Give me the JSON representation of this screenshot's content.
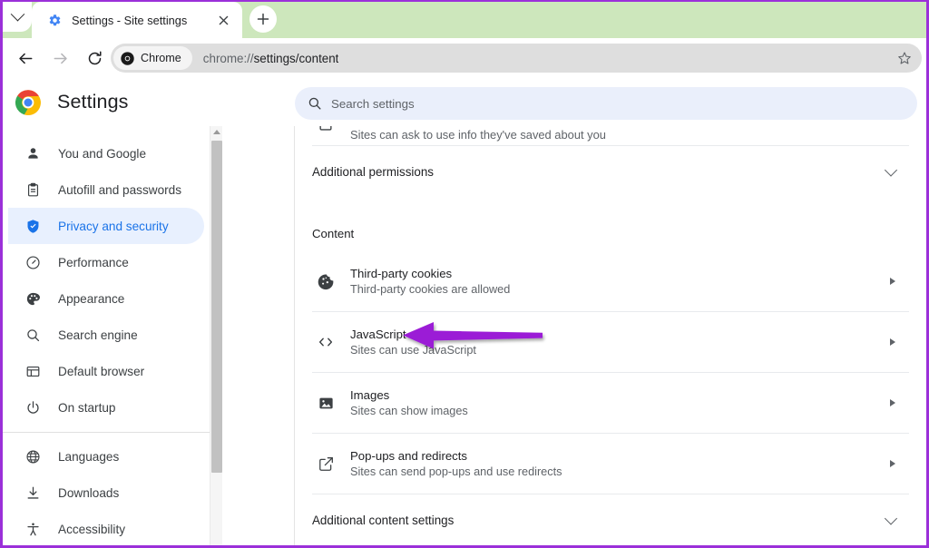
{
  "browser": {
    "tab_search_icon": "chevron-down-icon",
    "tab": {
      "favicon": "settings-gear-icon",
      "title": "Settings - Site settings",
      "close_icon": "close-icon"
    },
    "new_tab_label": "+",
    "toolbar": {
      "back_icon": "back-arrow-icon",
      "forward_icon": "forward-arrow-icon",
      "reload_icon": "reload-icon",
      "chip_label": "Chrome",
      "url_scheme": "chrome://",
      "url_path": "settings/content",
      "url_full": "chrome://settings/content",
      "bookmark_icon": "star-icon"
    },
    "colors": {
      "tabstrip_green": "#cde7bc",
      "window_border_purple": "#9b30d9",
      "omnibox_gray": "#dedede",
      "accent_blue": "#1a73e8",
      "active_pill": "#e8f0fe",
      "annotation_purple": "#9b1fd6"
    }
  },
  "settings": {
    "logo": "chrome-logo-icon",
    "title": "Settings",
    "search": {
      "icon": "search-icon",
      "placeholder": "Search settings",
      "value": ""
    }
  },
  "sidebar": {
    "items": [
      {
        "icon": "person-icon",
        "label": "You and Google",
        "active": false
      },
      {
        "icon": "clipboard-icon",
        "label": "Autofill and passwords",
        "active": false
      },
      {
        "icon": "shield-icon",
        "label": "Privacy and security",
        "active": true
      },
      {
        "icon": "speedometer-icon",
        "label": "Performance",
        "active": false
      },
      {
        "icon": "palette-icon",
        "label": "Appearance",
        "active": false
      },
      {
        "icon": "search-icon",
        "label": "Search engine",
        "active": false
      },
      {
        "icon": "browser-window-icon",
        "label": "Default browser",
        "active": false
      },
      {
        "icon": "power-icon",
        "label": "On startup",
        "active": false
      }
    ],
    "items_group2": [
      {
        "icon": "globe-icon",
        "label": "Languages",
        "active": false
      },
      {
        "icon": "download-icon",
        "label": "Downloads",
        "active": false
      },
      {
        "icon": "accessibility-icon",
        "label": "Accessibility",
        "active": false
      }
    ],
    "scrollbar": {
      "up_arrow_icon": "scroll-up-arrow-icon"
    }
  },
  "content": {
    "cut_off_row": {
      "icon": "partial-icon",
      "subtitle": "Sites can ask to use info they've saved about you"
    },
    "additional_permissions": {
      "label": "Additional permissions",
      "chevron": "chevron-down-icon"
    },
    "section_title": "Content",
    "rows": [
      {
        "icon": "cookie-icon",
        "title": "Third-party cookies",
        "subtitle": "Third-party cookies are allowed",
        "arrow": "chevron-right-icon"
      },
      {
        "icon": "code-brackets-icon",
        "title": "JavaScript",
        "subtitle": "Sites can use JavaScript",
        "arrow": "chevron-right-icon"
      },
      {
        "icon": "image-icon",
        "title": "Images",
        "subtitle": "Sites can show images",
        "arrow": "chevron-right-icon"
      },
      {
        "icon": "external-link-icon",
        "title": "Pop-ups and redirects",
        "subtitle": "Sites can send pop-ups and use redirects",
        "arrow": "chevron-right-icon"
      }
    ],
    "additional_content_settings": {
      "label": "Additional content settings",
      "chevron": "chevron-down-icon"
    }
  },
  "annotation": {
    "type": "arrow",
    "points_to": "JavaScript",
    "color": "#9b1fd6"
  }
}
